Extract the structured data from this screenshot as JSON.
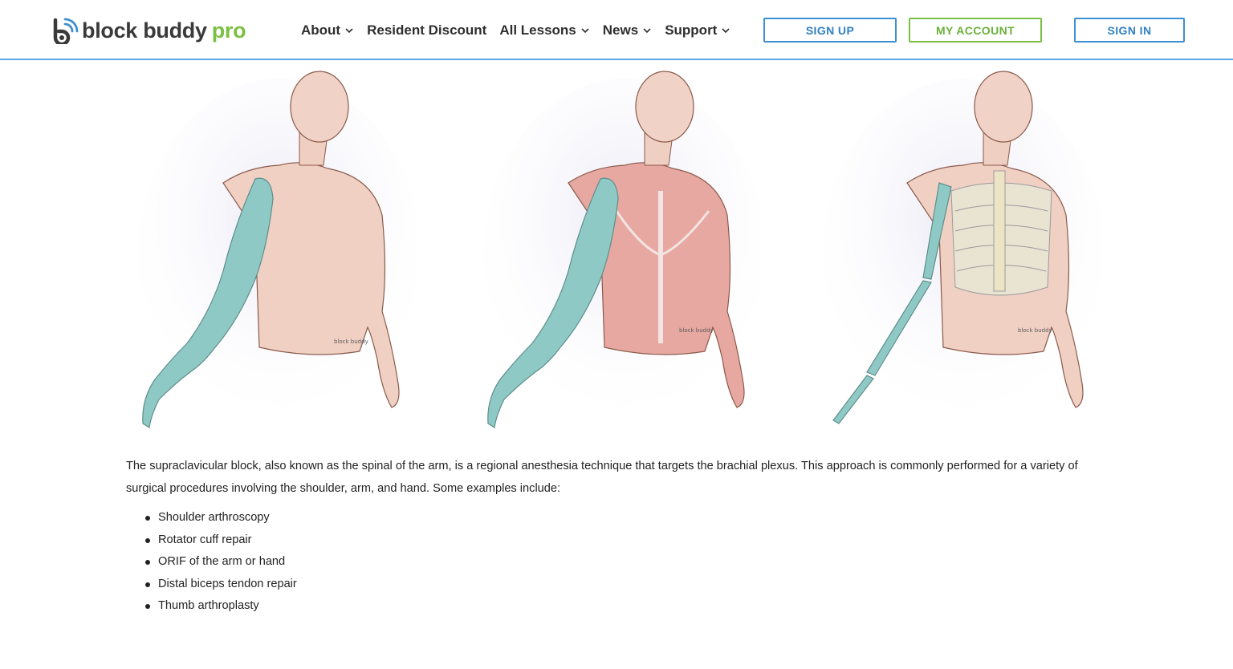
{
  "header": {
    "logo": {
      "name": "block buddy",
      "suffix": "pro"
    },
    "nav": [
      {
        "label": "About",
        "dropdown": true
      },
      {
        "label": "Resident Discount",
        "dropdown": false
      },
      {
        "label": "All Lessons",
        "dropdown": true
      },
      {
        "label": "News",
        "dropdown": true
      },
      {
        "label": "Support",
        "dropdown": true
      }
    ],
    "buttons": {
      "sign_up": "SIGN UP",
      "my_account": "MY ACCOUNT",
      "sign_in": "SIGN IN"
    }
  },
  "figures": [
    {
      "name": "dermatome-illustration",
      "signature": "block buddy"
    },
    {
      "name": "myotome-illustration",
      "signature": "block buddy"
    },
    {
      "name": "osteotome-illustration",
      "signature": "block buddy"
    }
  ],
  "content": {
    "paragraph": "The supraclavicular block, also known as the spinal of the arm, is a regional anesthesia technique that targets the brachial plexus. This approach is commonly performed for a variety of surgical procedures involving the shoulder, arm, and hand.  Some examples include:",
    "examples": [
      "Shoulder arthroscopy",
      "Rotator cuff repair",
      "ORIF of the arm or hand",
      "Distal biceps tendon repair",
      "Thumb arthroplasty"
    ]
  },
  "colors": {
    "brand_blue": "#3d8fd1",
    "brand_green": "#7bc043",
    "block_highlight": "#8fc9c6"
  }
}
